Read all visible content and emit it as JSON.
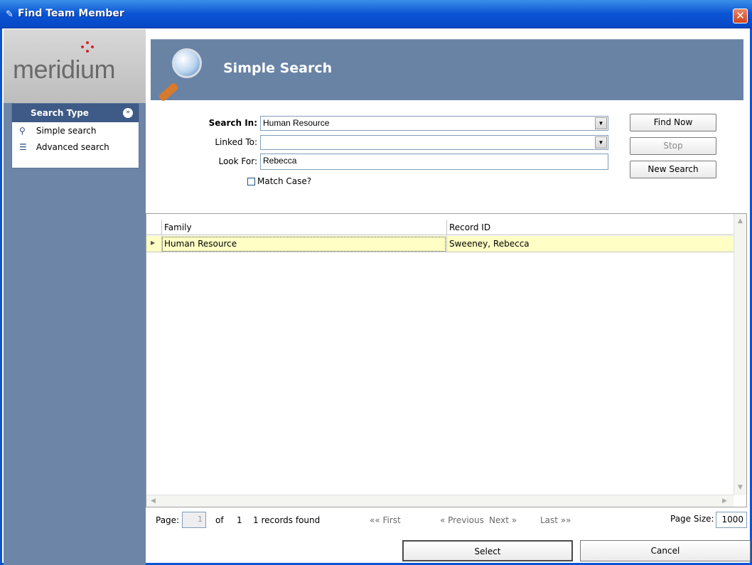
{
  "window": {
    "title": "Find Team Member"
  },
  "logo": {
    "text": "meridium"
  },
  "sidebar": {
    "header": "Search Type",
    "items": [
      {
        "label": "Simple search",
        "icon": "magnifier-icon"
      },
      {
        "label": "Advanced search",
        "icon": "advanced-search-icon"
      }
    ]
  },
  "banner": {
    "title": "Simple Search"
  },
  "form": {
    "search_in_label": "Search In:",
    "search_in_value": "Human Resource",
    "linked_to_label": "Linked To:",
    "linked_to_value": "",
    "look_for_label": "Look For:",
    "look_for_value": "Rebecca",
    "match_case_label": "Match Case?",
    "match_case_checked": false
  },
  "buttons": {
    "find_now": "Find Now",
    "stop": "Stop",
    "new_search": "New Search",
    "select": "Select",
    "cancel": "Cancel"
  },
  "grid": {
    "columns": [
      "Family",
      "Record ID"
    ],
    "rows": [
      [
        "Human Resource",
        "Sweeney, Rebecca"
      ]
    ]
  },
  "pager": {
    "page_label": "Page:",
    "page_value": "1",
    "of_label": "of",
    "total_pages": "1",
    "records_found": "1 records found",
    "first": "«« First",
    "previous": "« Previous",
    "next": "Next »",
    "last": "Last »»",
    "page_size_label": "Page Size:",
    "page_size_value": "1000"
  },
  "colors": {
    "titlebar": "#0a54d4",
    "sidebar": "#6d86a8",
    "banner": "#6983a5",
    "selected_row": "#ffffc5"
  }
}
